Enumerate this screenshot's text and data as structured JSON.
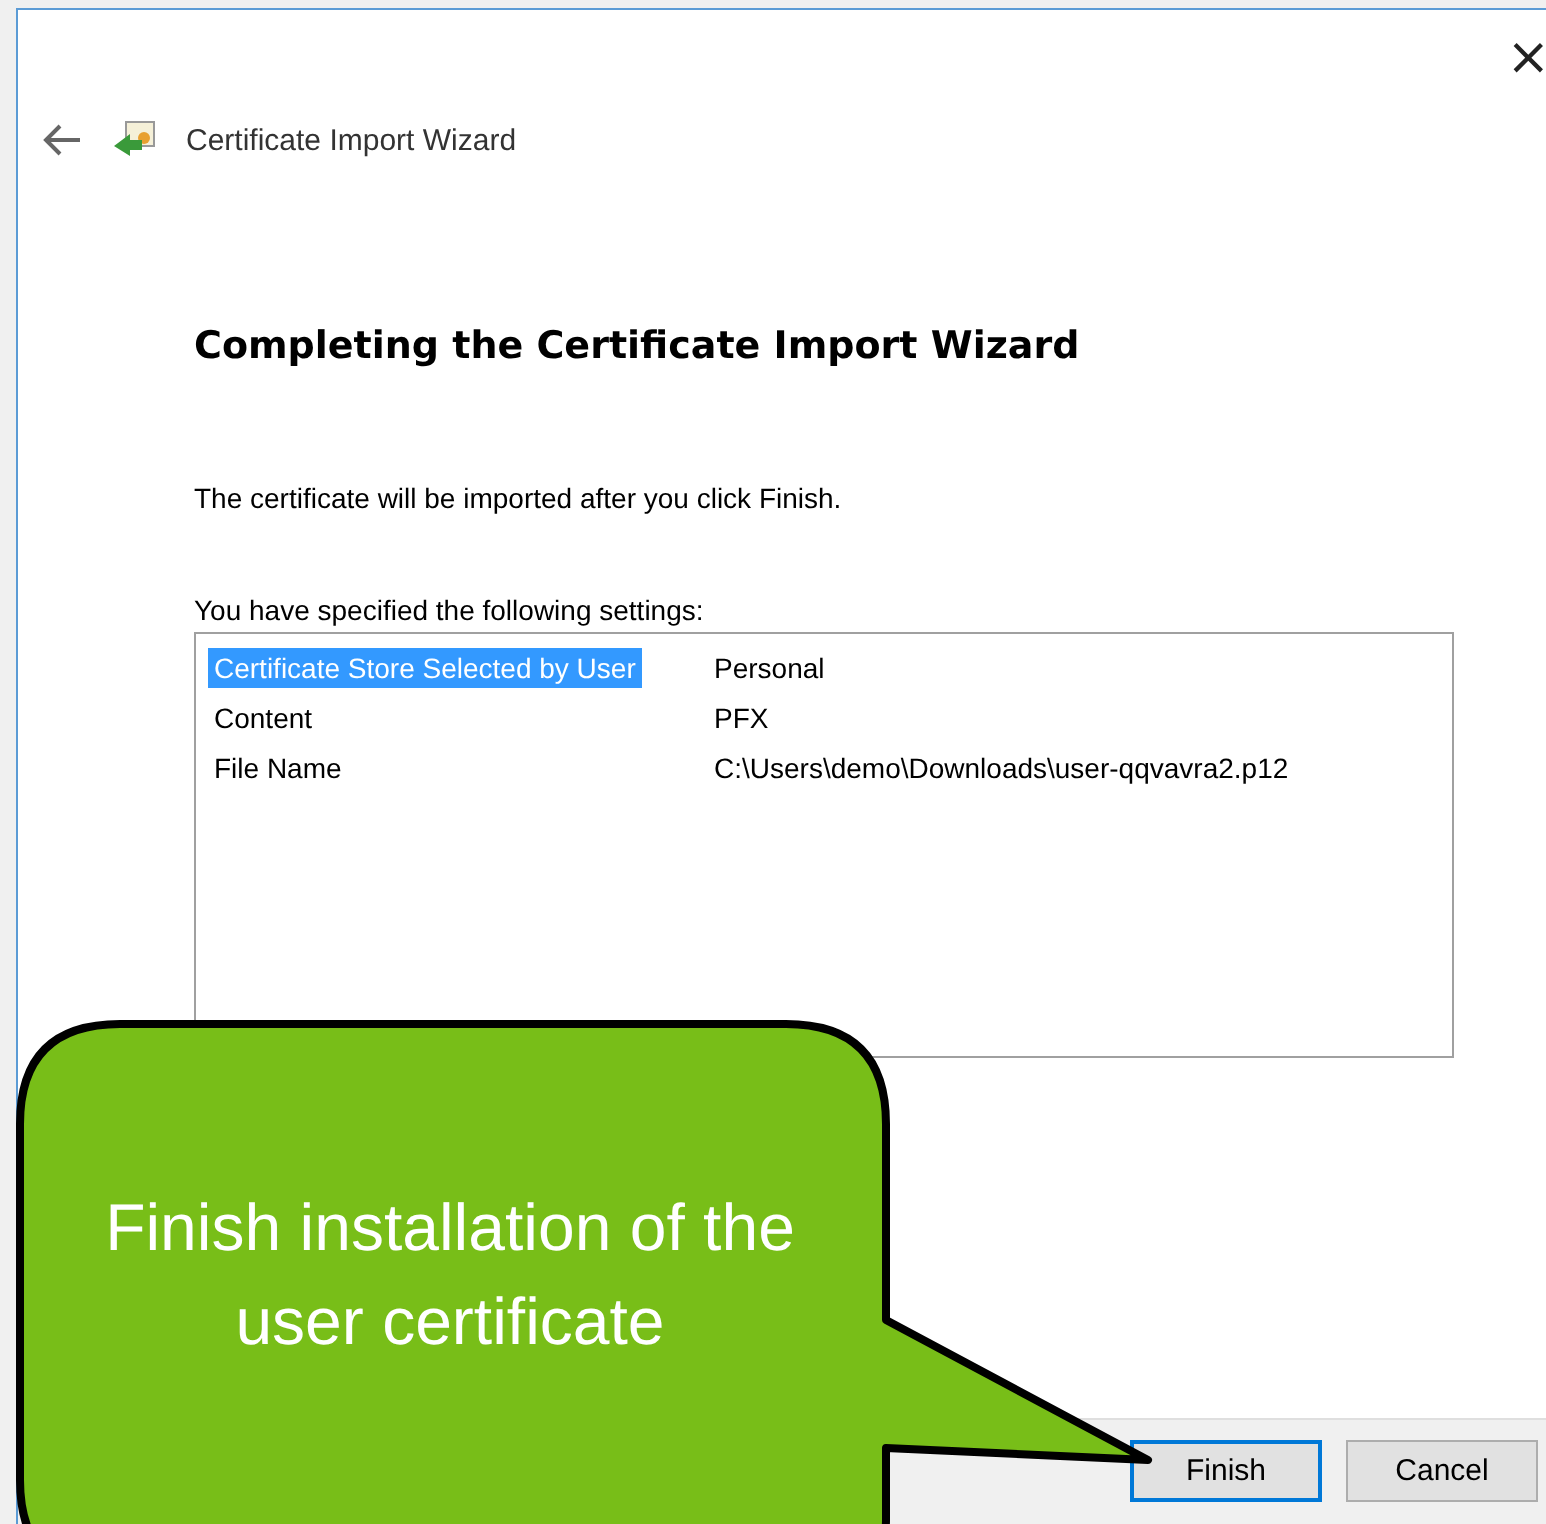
{
  "window": {
    "title": "Certificate Import Wizard",
    "close": "×"
  },
  "heading": "Completing the Certificate Import Wizard",
  "intro": "The certificate will be imported after you click Finish.",
  "settings_label": "You have specified the following settings:",
  "settings": [
    {
      "name": "Certificate Store Selected by User",
      "value": "Personal",
      "selected": true
    },
    {
      "name": "Content",
      "value": "PFX",
      "selected": false
    },
    {
      "name": "File Name",
      "value": "C:\\Users\\demo\\Downloads\\user-qqvavra2.p12",
      "selected": false
    }
  ],
  "buttons": [
    {
      "label": "Finish",
      "focused": true
    },
    {
      "label": "Cancel",
      "focused": false
    }
  ],
  "callout": {
    "text": "Finish installation of the user certificate"
  }
}
